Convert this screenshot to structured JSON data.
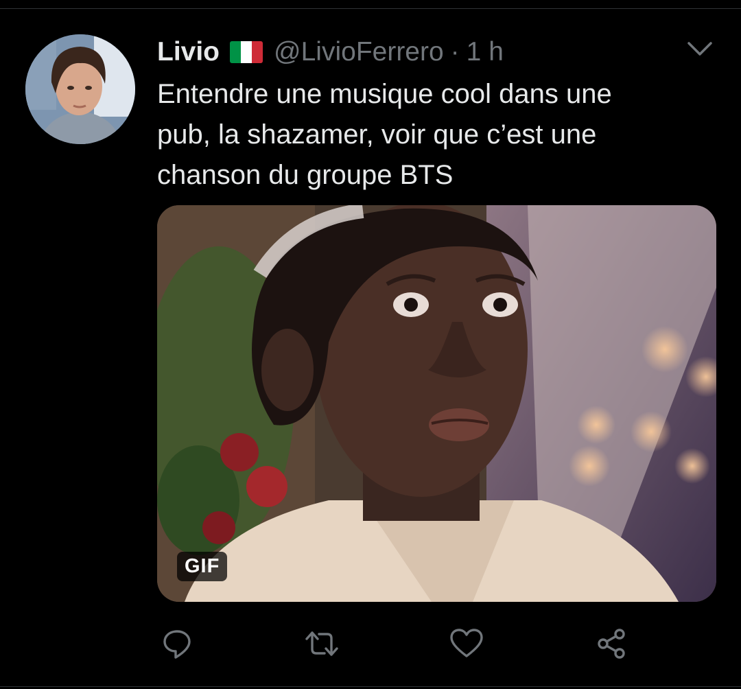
{
  "tweet": {
    "author_name": "Livio",
    "author_flag": "italy-flag",
    "handle": "@LivioFerrero",
    "separator": "·",
    "time": "1 h",
    "text_lines": [
      "Entendre une musique cool dans une",
      "pub, la shazamer, voir que c’est une",
      "chanson du groupe BTS"
    ],
    "media": {
      "type": "gif",
      "badge": "GIF"
    }
  },
  "actions": [
    "reply-icon",
    "retweet-icon",
    "like-icon",
    "share-icon"
  ],
  "colors": {
    "background": "#000000",
    "text_primary": "#e7e9ea",
    "text_secondary": "#71767b",
    "icon": "#71767b",
    "divider": "#2f3336",
    "flag_green": "#009246",
    "flag_white": "#ffffff",
    "flag_red": "#ce2b37"
  }
}
